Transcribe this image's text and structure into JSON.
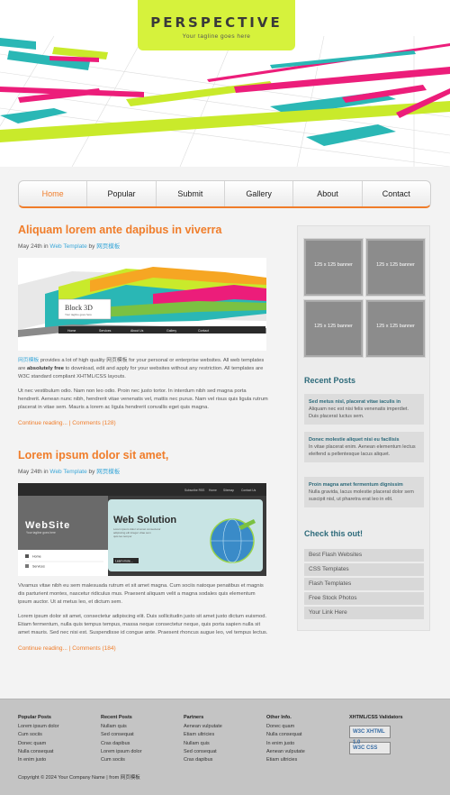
{
  "site": {
    "title": "PERSPECTIVE",
    "tagline": "Your tagline goes here"
  },
  "nav": [
    {
      "label": "Home",
      "active": true
    },
    {
      "label": "Popular"
    },
    {
      "label": "Submit"
    },
    {
      "label": "Gallery"
    },
    {
      "label": "About"
    },
    {
      "label": "Contact"
    }
  ],
  "posts": [
    {
      "title": "Aliquam lorem ante dapibus in viverra",
      "date": "May 24th in",
      "category": "Web Template",
      "by": "by",
      "author": "网页模板",
      "image_text": "Block 3D",
      "image_subtext": "Your tagline goes here",
      "para1_link": "网页模板",
      "para1_a": "provides a lot of high quality 网页模板 for your personal or enterprise websites. All web templates are",
      "para1_bold": "absolutely free",
      "para1_b": "to download, edit and apply for your websites without any restriction. All templates are W3C standard compliant XHTML/CSS layouts.",
      "para2": "Ut nec vestibulum odio. Nam non leo odio. Proin nec justo tortor. In interdum nibh sed magna porta hendrerit. Aenean nunc nibh, hendrerit vitae venenatis vel, mattis nec purus. Nam vel risus quis ligula rutrum placerat in vitae sem. Mauris a lorem ac ligula hendrerit convallis eget quis magna.",
      "continue": "Continue reading...",
      "sep": "|",
      "comments": "Comments (128)"
    },
    {
      "title": "Lorem ipsum dolor sit amet,",
      "date": "May 24th in",
      "category": "Web Template",
      "by": "by",
      "author": "网页模板",
      "image_brand": "WebSite",
      "image_brand_sub": "Your tagline goes here",
      "image_heading": "Web Solution",
      "image_menu": [
        "Home",
        "Services"
      ],
      "image_top_links": [
        "Subscribe RSS",
        "Home",
        "Sitemap",
        "Contact Us"
      ],
      "image_learn": "Learn more...",
      "para1": "Vivamus vitae nibh eu sem malesuada rutrum et sit amet magna. Cum sociis natoque penatibus et magnis dis parturient montes, nascetur ridiculus mus. Praesent aliquam velit a magna sodales quis elementum ipsum auctor. Ut at metus leo, et dictum sem.",
      "para2": "Lorem ipsum dolor sit amet, consectetur adipiscing elit. Duis sollicitudin justo sit amet justo dictum euismod. Etiam fermentum, nulla quis tempus tempus, massa neque consectetur neque, quis porta sapien nulla sit amet mauris. Sed nec nisi est. Suspendisse id congue ante. Praesent rhoncus augue leo, vel tempus lectus.",
      "continue": "Continue reading...",
      "sep": "|",
      "comments": "Comments (184)"
    }
  ],
  "sidebar": {
    "banner_label": "125 x 125 banner",
    "recent_title": "Recent Posts",
    "recent": [
      {
        "title": "Sed metus nisl, placerat vitae iaculis in",
        "text": "Aliquam nec est nisi felis venenatis imperdiet. Duis placerat luctus sem."
      },
      {
        "title": "Donec molestie aliquet nisi eu facilisis",
        "text": "In vitae placerat enim. Aenean elementum lectus eleifend a pellentesque lacus aliquet."
      },
      {
        "title": "Proin magna amet fermentum dignissim",
        "text": "Nulla gravida, lacus molestie placerat dolor sem suscipit nisl, ut pharetra erat leo in elit."
      }
    ],
    "check_title": "Check this out!",
    "check": [
      "Best Flash Websites",
      "CSS Templates",
      "Flash Templates",
      "Free Stock Photos",
      "Your Link Here"
    ]
  },
  "footer": {
    "columns": [
      {
        "heading": "Popular Posts",
        "items": [
          "Lorem ipsum dolor",
          "Cum sociis",
          "Donec quam",
          "Nulla consequat",
          "In enim justo"
        ]
      },
      {
        "heading": "Recent Posts",
        "items": [
          "Nullam quis",
          "Sed consequat",
          "Cras dapibus",
          "Lorem ipsum dolor",
          "Cum sociis"
        ]
      },
      {
        "heading": "Partners",
        "items": [
          "Aenean vulputate",
          "Etiam ultricies",
          "Nullam quis",
          "Sed consequat",
          "Cras dapibus"
        ]
      },
      {
        "heading": "Other Info.",
        "items": [
          "Donec quam",
          "Nulla consequat",
          "In enim justo",
          "Aenean vulputate",
          "Etiam ultricies"
        ]
      }
    ],
    "validators_heading": "XHTML/CSS Validators",
    "validators": [
      "W3C XHTML 1.0",
      "W3C CSS"
    ],
    "copyright_prefix": "Copyright © 2024",
    "copyright_company": "Your Company Name",
    "copyright_sep": "| from",
    "copyright_link": "网页模板"
  }
}
